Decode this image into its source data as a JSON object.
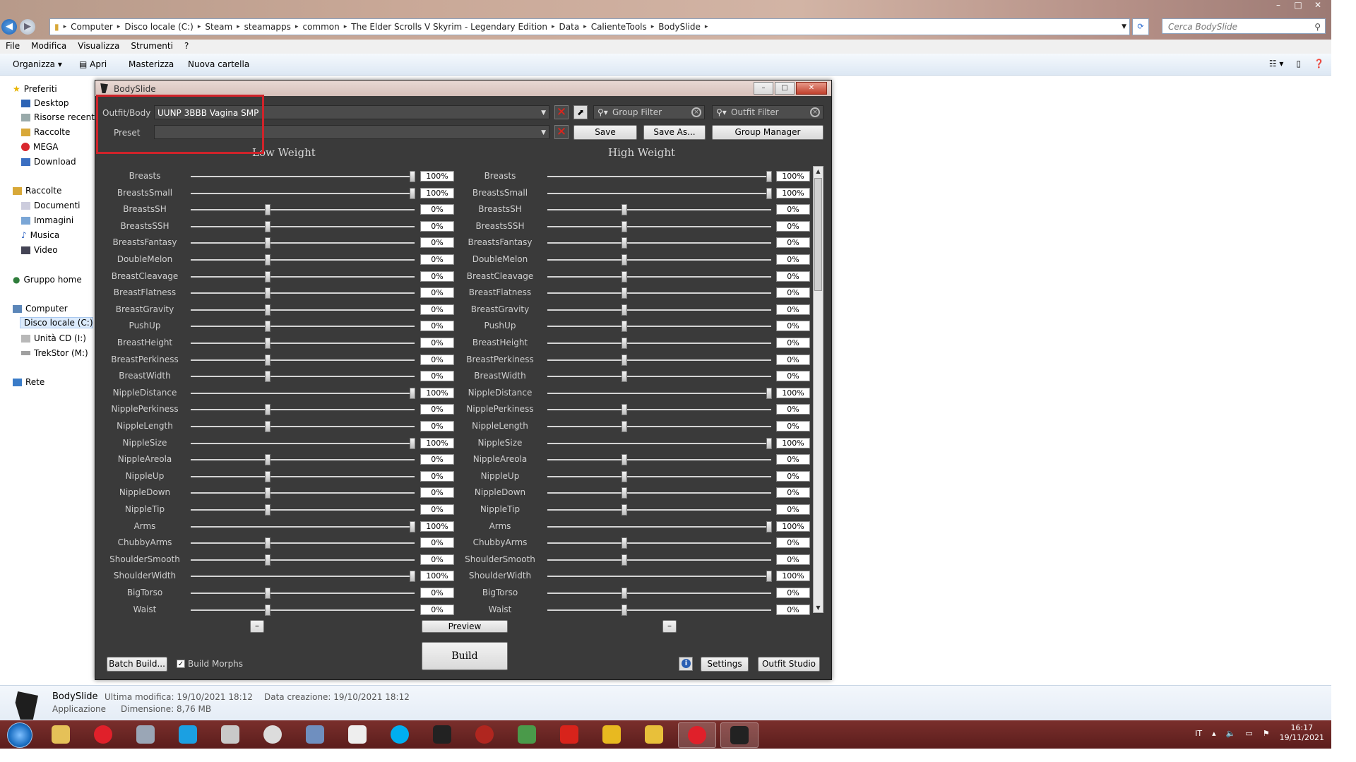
{
  "window_controls": [
    "–",
    "□",
    "✕"
  ],
  "explorer": {
    "breadcrumb": [
      "Computer",
      "Disco locale (C:)",
      "Steam",
      "steamapps",
      "common",
      "The Elder Scrolls V Skyrim - Legendary Edition",
      "Data",
      "CalienteTools",
      "BodySlide"
    ],
    "search_placeholder": "Cerca BodySlide",
    "menu": [
      "File",
      "Modifica",
      "Visualizza",
      "Strumenti",
      "?"
    ],
    "toolbar": {
      "organize": "Organizza",
      "open": "Apri",
      "burn": "Masterizza",
      "new_folder": "Nuova cartella"
    },
    "sidebar": {
      "favorites": "Preferiti",
      "fav_items": [
        "Desktop",
        "Risorse recenti",
        "Raccolte",
        "MEGA",
        "Download"
      ],
      "libraries": "Raccolte",
      "lib_items": [
        "Documenti",
        "Immagini",
        "Musica",
        "Video"
      ],
      "homegroup": "Gruppo home",
      "computer": "Computer",
      "comp_items": [
        "Disco locale (C:)",
        "Unità CD (I:)",
        "TrekStor (M:)"
      ],
      "network": "Rete"
    },
    "details": {
      "name": "BodySlide",
      "type": "Applicazione",
      "modified_label": "Ultima modifica: 19/10/2021 18:12",
      "created_label": "Data creazione: 19/10/2021 18:12",
      "size_label": "Dimensione: 8,76 MB"
    }
  },
  "taskbar": {
    "lang": "IT",
    "time": "16:17",
    "date": "19/11/2021",
    "icons": [
      "folder-icon",
      "opera-icon",
      "film-icon",
      "music-icon",
      "speaker-icon",
      "ffdec-icon",
      "pen-icon",
      "gift-icon",
      "skype-icon",
      "mmm-icon",
      "gear-red-icon",
      "table-icon",
      "f-icon",
      "chart-icon",
      "arrow-icon",
      "opera-red-icon",
      "bodyslide-icon"
    ],
    "colors": {
      "skype": "#00aff0",
      "opera": "#e0202a",
      "music": "#1ba0e2",
      "f": "#d8231b",
      "chart": "#e8b920",
      "table": "#4a9a4a"
    }
  },
  "bodyslide": {
    "title": "BodySlide",
    "outfit_label": "Outfit/Body",
    "outfit_value": "UUNP 3BBB Vagina SMP",
    "preset_label": "Preset",
    "preset_value": "",
    "group_filter_placeholder": "Group Filter",
    "outfit_filter_placeholder": "Outfit Filter",
    "save": "Save",
    "save_as": "Save As...",
    "group_manager": "Group Manager",
    "low_weight": "Low Weight",
    "high_weight": "High Weight",
    "preview": "Preview",
    "build": "Build",
    "batch_build": "Batch Build...",
    "build_morphs": "Build Morphs",
    "build_morphs_checked": true,
    "settings": "Settings",
    "outfit_studio": "Outfit Studio",
    "minus": "–",
    "sliders": [
      {
        "name": "Breasts",
        "low": "100%",
        "high": "100%",
        "lowv": 100,
        "highv": 100
      },
      {
        "name": "BreastsSmall",
        "low": "100%",
        "high": "100%",
        "lowv": 100,
        "highv": 100
      },
      {
        "name": "BreastsSH",
        "low": "0%",
        "high": "0%",
        "lowv": 0,
        "highv": 0
      },
      {
        "name": "BreastsSSH",
        "low": "0%",
        "high": "0%",
        "lowv": 0,
        "highv": 0
      },
      {
        "name": "BreastsFantasy",
        "low": "0%",
        "high": "0%",
        "lowv": 0,
        "highv": 0
      },
      {
        "name": "DoubleMelon",
        "low": "0%",
        "high": "0%",
        "lowv": 0,
        "highv": 0
      },
      {
        "name": "BreastCleavage",
        "low": "0%",
        "high": "0%",
        "lowv": 0,
        "highv": 0
      },
      {
        "name": "BreastFlatness",
        "low": "0%",
        "high": "0%",
        "lowv": 0,
        "highv": 0
      },
      {
        "name": "BreastGravity",
        "low": "0%",
        "high": "0%",
        "lowv": 0,
        "highv": 0
      },
      {
        "name": "PushUp",
        "low": "0%",
        "high": "0%",
        "lowv": 0,
        "highv": 0
      },
      {
        "name": "BreastHeight",
        "low": "0%",
        "high": "0%",
        "lowv": 0,
        "highv": 0
      },
      {
        "name": "BreastPerkiness",
        "low": "0%",
        "high": "0%",
        "lowv": 0,
        "highv": 0
      },
      {
        "name": "BreastWidth",
        "low": "0%",
        "high": "0%",
        "lowv": 0,
        "highv": 0
      },
      {
        "name": "NippleDistance",
        "low": "100%",
        "high": "100%",
        "lowv": 100,
        "highv": 100
      },
      {
        "name": "NipplePerkiness",
        "low": "0%",
        "high": "0%",
        "lowv": 0,
        "highv": 0
      },
      {
        "name": "NippleLength",
        "low": "0%",
        "high": "0%",
        "lowv": 0,
        "highv": 0
      },
      {
        "name": "NippleSize",
        "low": "100%",
        "high": "100%",
        "lowv": 100,
        "highv": 100
      },
      {
        "name": "NippleAreola",
        "low": "0%",
        "high": "0%",
        "lowv": 0,
        "highv": 0
      },
      {
        "name": "NippleUp",
        "low": "0%",
        "high": "0%",
        "lowv": 0,
        "highv": 0
      },
      {
        "name": "NippleDown",
        "low": "0%",
        "high": "0%",
        "lowv": 0,
        "highv": 0
      },
      {
        "name": "NippleTip",
        "low": "0%",
        "high": "0%",
        "lowv": 0,
        "highv": 0
      },
      {
        "name": "Arms",
        "low": "100%",
        "high": "100%",
        "lowv": 100,
        "highv": 100
      },
      {
        "name": "ChubbyArms",
        "low": "0%",
        "high": "0%",
        "lowv": 0,
        "highv": 0
      },
      {
        "name": "ShoulderSmooth",
        "low": "0%",
        "high": "0%",
        "lowv": 0,
        "highv": 0
      },
      {
        "name": "ShoulderWidth",
        "low": "100%",
        "high": "100%",
        "lowv": 100,
        "highv": 100
      },
      {
        "name": "BigTorso",
        "low": "0%",
        "high": "0%",
        "lowv": 0,
        "highv": 0
      },
      {
        "name": "Waist",
        "low": "0%",
        "high": "0%",
        "lowv": 0,
        "highv": 0
      }
    ]
  }
}
